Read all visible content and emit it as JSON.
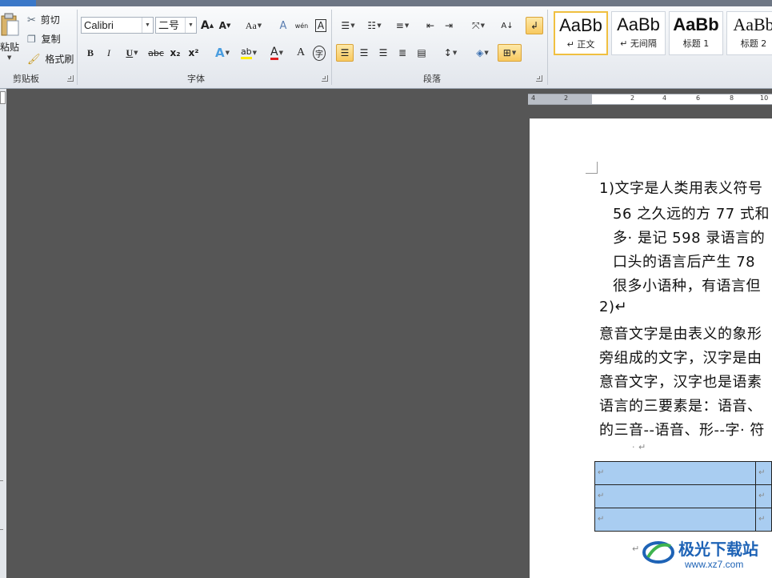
{
  "clipboard": {
    "paste_label": "粘贴",
    "cut_label": "剪切",
    "copy_label": "复制",
    "format_painter_label": "格式刷",
    "group_label": "剪贴板"
  },
  "font": {
    "font_name": "Calibri",
    "font_size": "二号",
    "group_label": "字体",
    "bold": "B",
    "italic": "I",
    "underline": "U",
    "strikethrough": "abc",
    "subscript": "x₂",
    "superscript": "x²",
    "grow": "A",
    "shrink": "A",
    "change_case": "Aa",
    "clear_format": "A",
    "phonetic": "wén",
    "border_char": "A",
    "text_effect": "A",
    "highlight": "ab",
    "font_color": "A",
    "char_shading": "A",
    "enclose_char": "字"
  },
  "paragraph": {
    "group_label": "段落"
  },
  "styles": {
    "items": [
      {
        "sample": "AaBb",
        "name": "↵ 正文",
        "selected": true
      },
      {
        "sample": "AaBb",
        "name": "↵ 无间隔",
        "selected": false
      },
      {
        "sample": "AaBb",
        "name": "标题 1",
        "selected": false
      },
      {
        "sample": "AaBb",
        "name": "标题 2",
        "selected": false
      }
    ]
  },
  "ruler": {
    "ticks": [
      "4",
      "2",
      "2",
      "4",
      "6",
      "8",
      "10"
    ]
  },
  "document": {
    "lines": [
      "1)文字是人类用表义符号",
      "56 之久远的方 77 式和",
      "多· 是记 598 录语言的",
      "口头的语言后产生 78",
      "很多小语种，有语言但",
      "2)↵",
      "意音文字是由表义的象形",
      "旁组成的文字，汉字是由",
      "意音文字，汉字也是语素",
      "语言的三要素是：语音、",
      "的三音--语音、形--字· 符",
      "· ↵"
    ],
    "cell_mark": "↵",
    "after_table_mark": "↵"
  },
  "watermark": {
    "site_name": "极光下载站",
    "url": "www.xz7.com"
  },
  "colors": {
    "ribbon_bg": "#eceff3",
    "canvas_bg": "#565656",
    "table_fill": "#a9cdf1",
    "selected_btn": "#f8c95f",
    "watermark_blue": "#1e63b6"
  }
}
